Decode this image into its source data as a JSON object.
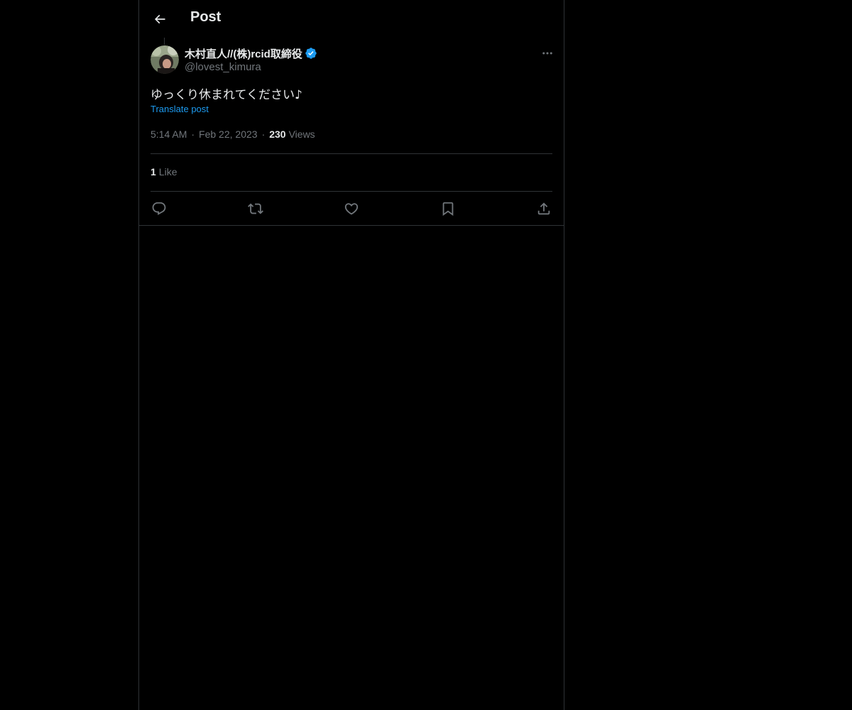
{
  "header": {
    "title": "Post",
    "back_icon": "arrow-left-icon"
  },
  "post": {
    "author": {
      "display_name": "木村直人//(株)rcid取締役",
      "handle": "@lovest_kimura",
      "verified": true,
      "verified_color": "#1d9bf0"
    },
    "text": "ゆっくり休まれてください♪",
    "translate_label": "Translate post",
    "time": "5:14 AM",
    "date": "Feb 22, 2023",
    "views_count": "230",
    "views_label": "Views",
    "likes_count": "1",
    "likes_label": "Like",
    "separator": "·"
  },
  "actions": [
    {
      "name": "reply",
      "icon": "reply-icon"
    },
    {
      "name": "repost",
      "icon": "repost-icon"
    },
    {
      "name": "like",
      "icon": "heart-icon"
    },
    {
      "name": "bookmark",
      "icon": "bookmark-icon"
    },
    {
      "name": "share",
      "icon": "share-icon"
    }
  ],
  "colors": {
    "background": "#000000",
    "text_primary": "#e7e9ea",
    "text_secondary": "#71767b",
    "accent": "#1d9bf0",
    "border": "#2f3336"
  }
}
